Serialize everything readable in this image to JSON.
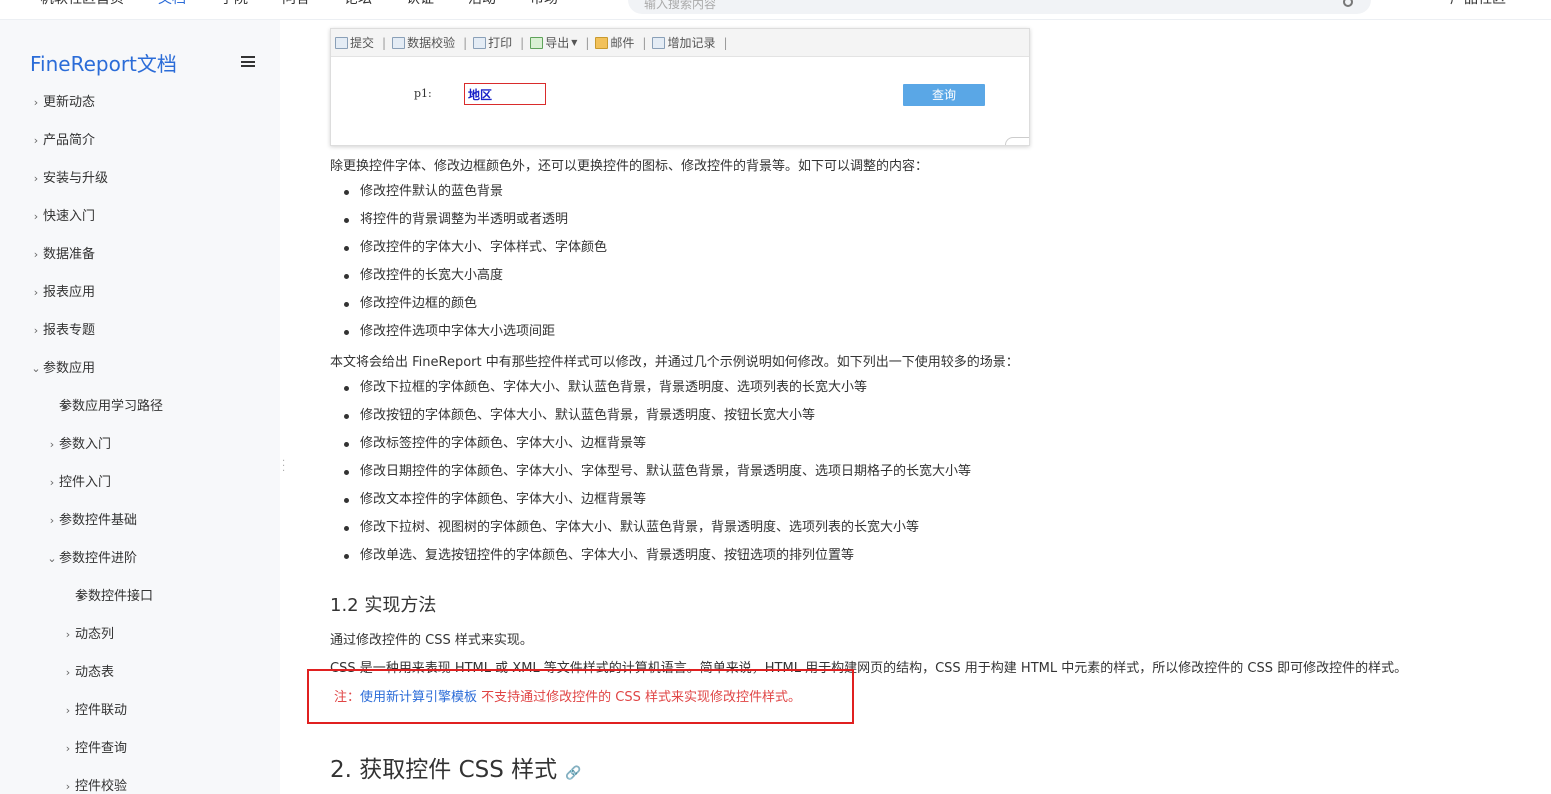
{
  "topnav": {
    "items": [
      "帆软社区首页",
      "文档",
      "学院",
      "问答",
      "论坛",
      "认证",
      "活动",
      "市场"
    ],
    "active_index": 1,
    "search_placeholder": "输入搜索内容",
    "right_label": "产品社区"
  },
  "sidebar": {
    "brand": "FineReport文档",
    "items": [
      {
        "label": "更新动态",
        "level": 0,
        "marker": "arrow-right"
      },
      {
        "label": "产品简介",
        "level": 0,
        "marker": "arrow-right"
      },
      {
        "label": "安装与升级",
        "level": 0,
        "marker": "arrow-right"
      },
      {
        "label": "快速入门",
        "level": 0,
        "marker": "arrow-right"
      },
      {
        "label": "数据准备",
        "level": 0,
        "marker": "arrow-right"
      },
      {
        "label": "报表应用",
        "level": 0,
        "marker": "arrow-right"
      },
      {
        "label": "报表专题",
        "level": 0,
        "marker": "arrow-right"
      },
      {
        "label": "参数应用",
        "level": 0,
        "marker": "arrow-down"
      },
      {
        "label": "参数应用学习路径",
        "level": 1,
        "marker": "dot"
      },
      {
        "label": "参数入门",
        "level": 1,
        "marker": "arrow-right"
      },
      {
        "label": "控件入门",
        "level": 1,
        "marker": "arrow-right"
      },
      {
        "label": "参数控件基础",
        "level": 1,
        "marker": "arrow-right"
      },
      {
        "label": "参数控件进阶",
        "level": 1,
        "marker": "arrow-down"
      },
      {
        "label": "参数控件接口",
        "level": 2,
        "marker": "dot"
      },
      {
        "label": "动态列",
        "level": 2,
        "marker": "arrow-right"
      },
      {
        "label": "动态表",
        "level": 2,
        "marker": "arrow-right"
      },
      {
        "label": "控件联动",
        "level": 2,
        "marker": "arrow-right"
      },
      {
        "label": "控件查询",
        "level": 2,
        "marker": "arrow-right"
      },
      {
        "label": "控件校验",
        "level": 2,
        "marker": "arrow-right"
      }
    ]
  },
  "demo": {
    "toolbar": [
      {
        "label": "提交",
        "icon": "submit-icon"
      },
      {
        "label": "数据校验",
        "icon": "check-icon"
      },
      {
        "label": "打印",
        "icon": "print-icon"
      },
      {
        "label": "导出",
        "icon": "export-icon",
        "caret": true
      },
      {
        "label": "邮件",
        "icon": "mail-icon"
      },
      {
        "label": "增加记录",
        "icon": "add-record-icon"
      }
    ],
    "param_label": "p1:",
    "param_value": "地区",
    "query_button": "查询"
  },
  "content": {
    "intro1": "除更换控件字体、修改边框颜色外，还可以更换控件的图标、修改控件的背景等。如下可以调整的内容：",
    "list1": [
      "修改控件默认的蓝色背景",
      "将控件的背景调整为半透明或者透明",
      "修改控件的字体大小、字体样式、字体颜色",
      "修改控件的长宽大小高度",
      "修改控件边框的颜色",
      "修改控件选项中字体大小选项间距"
    ],
    "intro2": "本文将会给出 FineReport 中有那些控件样式可以修改，并通过几个示例说明如何修改。如下列出一下使用较多的场景：",
    "list2": [
      "修改下拉框的字体颜色、字体大小、默认蓝色背景，背景透明度、选项列表的长宽大小等",
      "修改按钮的字体颜色、字体大小、默认蓝色背景，背景透明度、按钮长宽大小等",
      "修改标签控件的字体颜色、字体大小、边框背景等",
      "修改日期控件的字体颜色、字体大小、字体型号、默认蓝色背景，背景透明度、选项日期格子的长宽大小等",
      "修改文本控件的字体颜色、字体大小、边框背景等",
      "修改下拉树、视图树的字体颜色、字体大小、默认蓝色背景，背景透明度、选项列表的长宽大小等",
      "修改单选、复选按钮控件的字体颜色、字体大小、背景透明度、按钮选项的排列位置等"
    ],
    "h3": "1.2 实现方法",
    "p_method": "通过修改控件的 CSS 样式来实现。",
    "p_css": "CSS 是一种用来表现 HTML 或 XML 等文件样式的计算机语言。简单来说，HTML 用于构建网页的结构，CSS 用于构建 HTML 中元素的样式，所以修改控件的 CSS 即可修改控件的样式。",
    "note_prefix": "注：",
    "note_link": "使用新计算引擎模板",
    "note_rest": " 不支持通过修改控件的 CSS 样式来实现修改控件样式。",
    "h2": "2. 获取控件 CSS 样式"
  },
  "colors": {
    "brand": "#2b6cd8",
    "note_red": "#e04545",
    "highlight_border": "#e02020",
    "query_button": "#5aa7e6"
  }
}
